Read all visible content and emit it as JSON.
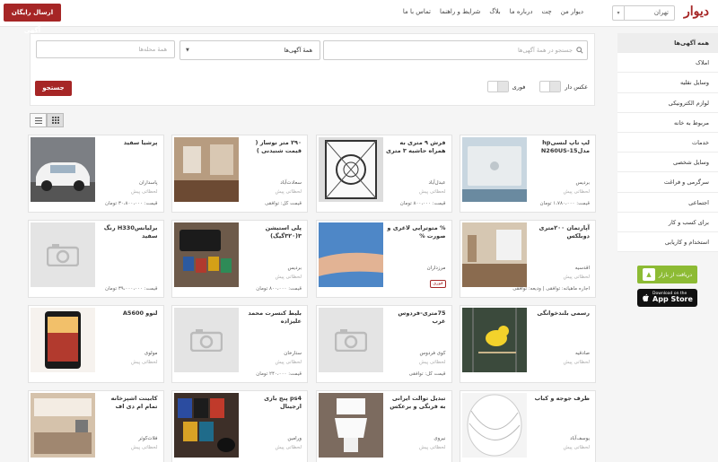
{
  "header": {
    "logo": "دیوار",
    "city": "تهران",
    "nav": [
      "دیوار من",
      "چت",
      "درباره ما",
      "بلاگ",
      "شرایط و راهنما",
      "تماس با ما"
    ],
    "post_button": "ارسال رایگان آگهی"
  },
  "sidebar": {
    "items": [
      "همه آگهی‌ها",
      "املاک",
      "وسایل نقلیه",
      "لوازم الکترونیکی",
      "مربوط به خانه",
      "خدمات",
      "وسایل شخصی",
      "سرگرمی و فراغت",
      "اجتماعی",
      "برای کسب و کار",
      "استخدام و کاریابی"
    ],
    "bazaar_text": "دریافت از بازار",
    "appstore_small": "Download on the",
    "appstore_big": "App Store"
  },
  "filters": {
    "search_placeholder": "جستجو در همهٔ آگهی‌ها",
    "category_value": "همهٔ آگهی‌ها",
    "neighborhood_placeholder": "همهٔ محله‌ها",
    "photo_toggle_label": "عکس دار",
    "urgent_toggle_label": "فوری",
    "search_button": "جستجو"
  },
  "listings": [
    {
      "title": "لپ تاپ لنسیhp مدلN260US-15",
      "loc": "بردیس",
      "sub": "لحظاتی پیش",
      "price": "قیمت: ۱،۷۸۰،۰۰۰ تومان",
      "photo": "laptop"
    },
    {
      "title": "فرش ۹ متری به همراه حاشیه ۳ متری",
      "loc": "عبدل‌آباد",
      "sub": "لحظاتی پیش",
      "price": "قیمت: ۸۰۰،۰۰۰ تومان",
      "photo": "rug"
    },
    {
      "title": "۲۹۰ متر نوساز ( قیمت شنیدنی )",
      "loc": "سعادت‌آباد",
      "sub": "لحظاتی پیش",
      "price": "قیمت کل: توافقی",
      "photo": "interior"
    },
    {
      "title": "پرشیا سفید",
      "loc": "پاسداران",
      "sub": "لحظاتی پیش",
      "price": "قیمت: ۳۰،۸۰۰،۰۰۰ تومان",
      "photo": "car"
    },
    {
      "title": "آپارتمان ۲۰۰متری دوبلکس",
      "loc": "اقدسیه",
      "sub": "لحظاتی پیش",
      "price": "اجاره ماهیانه: توافقی | ودیعه: توافقی",
      "photo": "apartment"
    },
    {
      "title": "% متوترایی لاغری و صورت %",
      "loc": "مرزداران",
      "sub": "",
      "price": "",
      "photo": "arm",
      "badge": "فوری"
    },
    {
      "title": "پلی استیشن ۳(۳۲۰گیگ)",
      "loc": "بردیس",
      "sub": "لحظاتی پیش",
      "price": "قیمت: ۸۰۰،۰۰۰ تومان",
      "photo": "console"
    },
    {
      "title": "برلیانسH330 رنگ سفید",
      "loc": "",
      "sub": "",
      "price": "قیمت: ۳۹،۰۰۰،۰۰۰ تومان",
      "photo": "none"
    },
    {
      "title": "رسمی بلندخوانگی",
      "loc": "صادقیه",
      "sub": "لحظاتی پیش",
      "price": "",
      "photo": "bird"
    },
    {
      "title": "75متری-فردوس غرب",
      "loc": "کوی فردوس",
      "sub": "لحظاتی پیش",
      "price": "قیمت کل: توافقی",
      "photo": "none"
    },
    {
      "title": "بلیط کنسرت محمد علیزاده",
      "loc": "ستارخان",
      "sub": "لحظاتی پیش",
      "price": "قیمت: ۲۴۰،۰۰۰ تومان",
      "photo": "none"
    },
    {
      "title": "لنوو A5600",
      "loc": "مولوی",
      "sub": "لحظاتی پیش",
      "price": "",
      "photo": "phone"
    },
    {
      "title": "ظرف جوجه و کباب",
      "loc": "یوسف‌آباد",
      "sub": "لحظاتی پیش",
      "price": "",
      "photo": "plate"
    },
    {
      "title": "تبدیل توالت ایرانی به فرنگی و برعکس",
      "loc": "نیروی",
      "sub": "لحظاتی پیش",
      "price": "",
      "photo": "toilet"
    },
    {
      "title": "ps4 پنج بازی ارجینال",
      "loc": "ورامین",
      "sub": "لحظاتی پیش",
      "price": "",
      "photo": "games"
    },
    {
      "title": "کابینت اشپزخانه تمام ام دی اف",
      "loc": "فلات‌کوثر",
      "sub": "لحظاتی پیش",
      "price": "",
      "photo": "kitchen"
    }
  ]
}
